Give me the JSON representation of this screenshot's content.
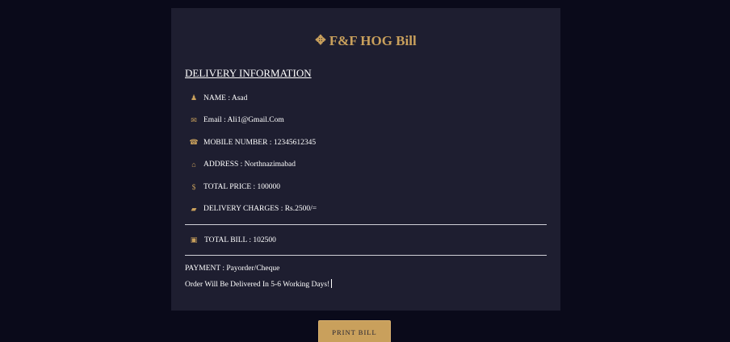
{
  "brand": {
    "icon": "crosshair-diamond-icon",
    "icon_glyph": "✥",
    "title": "F&F HOG Bill",
    "accent_color": "#c9a05c"
  },
  "delivery": {
    "heading": "DELIVERY INFORMATION",
    "rows": [
      {
        "icon": "user-icon",
        "glyph": "♟",
        "text": "NAME : Asad"
      },
      {
        "icon": "envelope-icon",
        "glyph": "✉",
        "text": "Email : Ali1@Gmail.Com"
      },
      {
        "icon": "phone-icon",
        "glyph": "☎",
        "text": "MOBILE NUMBER : 12345612345"
      },
      {
        "icon": "home-icon",
        "glyph": "⌂",
        "text": "ADDRESS : Northnazimabad"
      },
      {
        "icon": "dollar-icon",
        "glyph": "$",
        "text": "TOTAL PRICE : 100000"
      },
      {
        "icon": "truck-icon",
        "glyph": "▰",
        "text": "DELIVERY CHARGES : Rs.2500/="
      }
    ],
    "total": {
      "icon": "money-bill-icon",
      "glyph": "▣",
      "text": "TOTAL BILL : 102500"
    },
    "payment": "PAYMENT : Payorder/Cheque",
    "note": "Order Will Be Delivered In 5-6 Working Days!"
  },
  "actions": {
    "print_label": "PRINT BILL"
  },
  "colors": {
    "background": "#0a0a1a",
    "card": "#1e1e30",
    "button": "#c9a05c"
  }
}
